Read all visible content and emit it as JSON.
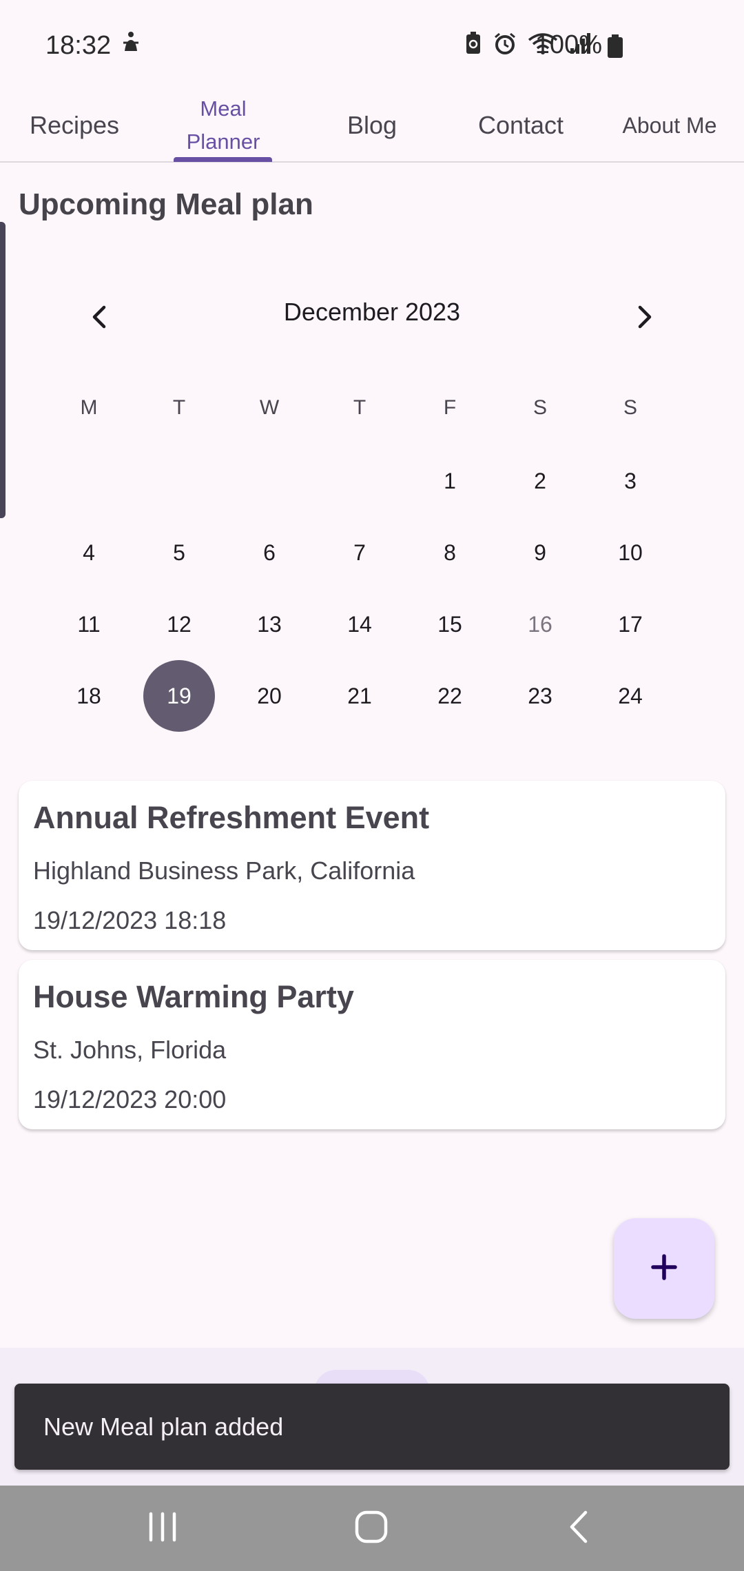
{
  "status_bar": {
    "time": "18:32",
    "battery_text": "100%",
    "icons": [
      "accessibility-icon",
      "battery-saver-icon",
      "alarm-icon",
      "wifi-icon",
      "signal-icon",
      "battery-icon"
    ]
  },
  "tabs": [
    {
      "label": "Recipes"
    },
    {
      "label": "Meal Planner",
      "line1": "Meal",
      "line2": "Planner",
      "active": true
    },
    {
      "label": "Blog"
    },
    {
      "label": "Contact"
    },
    {
      "label": "About Me"
    }
  ],
  "section_title": "Upcoming Meal plan",
  "calendar": {
    "month_label": "December 2023",
    "weekdays": [
      "M",
      "T",
      "W",
      "T",
      "F",
      "S",
      "S"
    ],
    "weeks": [
      [
        "",
        "",
        "",
        "",
        "1",
        "2",
        "3"
      ],
      [
        "4",
        "5",
        "6",
        "7",
        "8",
        "9",
        "10"
      ],
      [
        "11",
        "12",
        "13",
        "14",
        "15",
        "16",
        "17"
      ],
      [
        "18",
        "19",
        "20",
        "21",
        "22",
        "23",
        "24"
      ]
    ],
    "today": "16",
    "selected": "19"
  },
  "events": [
    {
      "title": "Annual Refreshment Event",
      "location": "Highland Business Park, California",
      "datetime": "19/12/2023 18:18"
    },
    {
      "title": "House Warming Party",
      "location": "St. Johns, Florida",
      "datetime": "19/12/2023 20:00"
    }
  ],
  "fab": {
    "icon": "plus-icon"
  },
  "snackbar": {
    "message": "New Meal plan added"
  },
  "colors": {
    "accent": "#6750a4",
    "selected_day": "#635b70",
    "fab_bg": "#eaddff",
    "background": "#fdf7fc"
  }
}
